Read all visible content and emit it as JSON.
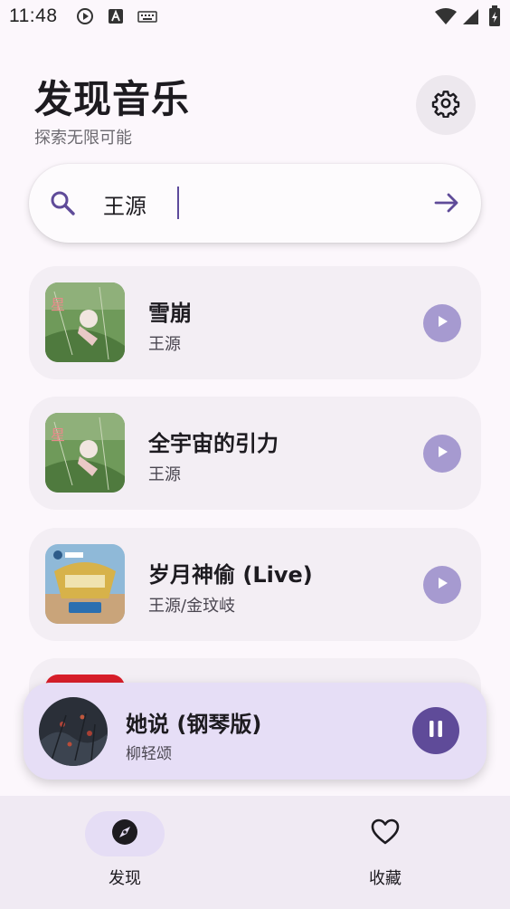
{
  "status_bar": {
    "time": "11:48",
    "icons": [
      "play-circle-icon",
      "font-a-icon",
      "keyboard-icon",
      "wifi-icon",
      "signal-icon",
      "battery-icon"
    ]
  },
  "header": {
    "title": "发现音乐",
    "subtitle": "探索无限可能",
    "settings_icon": "gear-icon"
  },
  "search": {
    "value": "王源",
    "placeholder": "",
    "left_icon": "search-icon",
    "right_icon": "arrow-right-icon"
  },
  "songs": [
    {
      "title": "雪崩",
      "artist": "王源",
      "cover": "album-cover-green"
    },
    {
      "title": "全宇宙的引力",
      "artist": "王源",
      "cover": "album-cover-green"
    },
    {
      "title": "岁月神偷 (Live)",
      "artist": "王源/金玟岐",
      "cover": "album-cover-show"
    },
    {
      "title": "",
      "artist": "",
      "cover": "album-cover-red"
    }
  ],
  "now_playing": {
    "title": "她说 (钢琴版)",
    "artist": "柳轻颂",
    "state": "playing"
  },
  "bottom_nav": [
    {
      "label": "发现",
      "icon": "compass-icon",
      "active": true
    },
    {
      "label": "收藏",
      "icon": "heart-icon",
      "active": false
    }
  ],
  "colors": {
    "background": "#fcf7fc",
    "card": "#f3eef4",
    "accent": "#5f4b99",
    "play_button": "#a69ad0",
    "player_bg": "#e6def6",
    "nav_bg": "#f0eaf3"
  }
}
